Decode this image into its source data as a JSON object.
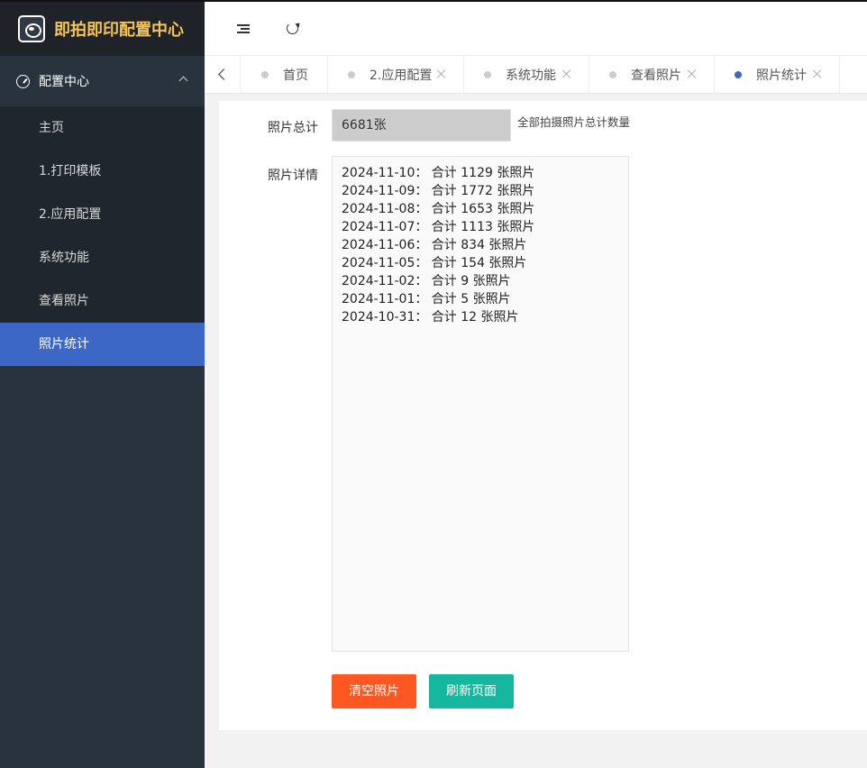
{
  "app": {
    "logo_text": "即拍即印配置中心"
  },
  "sidebar": {
    "group_label": "配置中心",
    "items": [
      {
        "label": "主页"
      },
      {
        "label": "1.打印模板"
      },
      {
        "label": "2.应用配置"
      },
      {
        "label": "系统功能"
      },
      {
        "label": "查看照片"
      },
      {
        "label": "照片统计",
        "active": true
      }
    ]
  },
  "tabs": [
    {
      "label": "首页",
      "closable": false
    },
    {
      "label": "2.应用配置",
      "closable": true
    },
    {
      "label": "系统功能",
      "closable": true
    },
    {
      "label": "查看照片",
      "closable": true
    },
    {
      "label": "照片统计",
      "closable": true,
      "active": true
    }
  ],
  "form": {
    "total_label": "照片总计",
    "total_value": "6681张",
    "total_hint": "全部拍摄照片总计数量",
    "detail_label": "照片详情",
    "detail_lines": [
      "2024-11-10： 合计 1129 张照片",
      "2024-11-09： 合计 1772 张照片",
      "2024-11-08： 合计 1653 张照片",
      "2024-11-07： 合计 1113 张照片",
      "2024-11-06： 合计 834 张照片",
      "2024-11-05： 合计 154 张照片",
      "2024-11-02： 合计 9 张照片",
      "2024-11-01： 合计 5 张照片",
      "2024-10-31： 合计 12 张照片"
    ]
  },
  "buttons": {
    "clear_label": "清空照片",
    "refresh_label": "刷新页面"
  },
  "colors": {
    "sidebar_bg": "#28333e",
    "active_blue": "#3c67c6",
    "logo_yellow": "#f4c552",
    "danger": "#ff5722",
    "success": "#16b79f"
  }
}
